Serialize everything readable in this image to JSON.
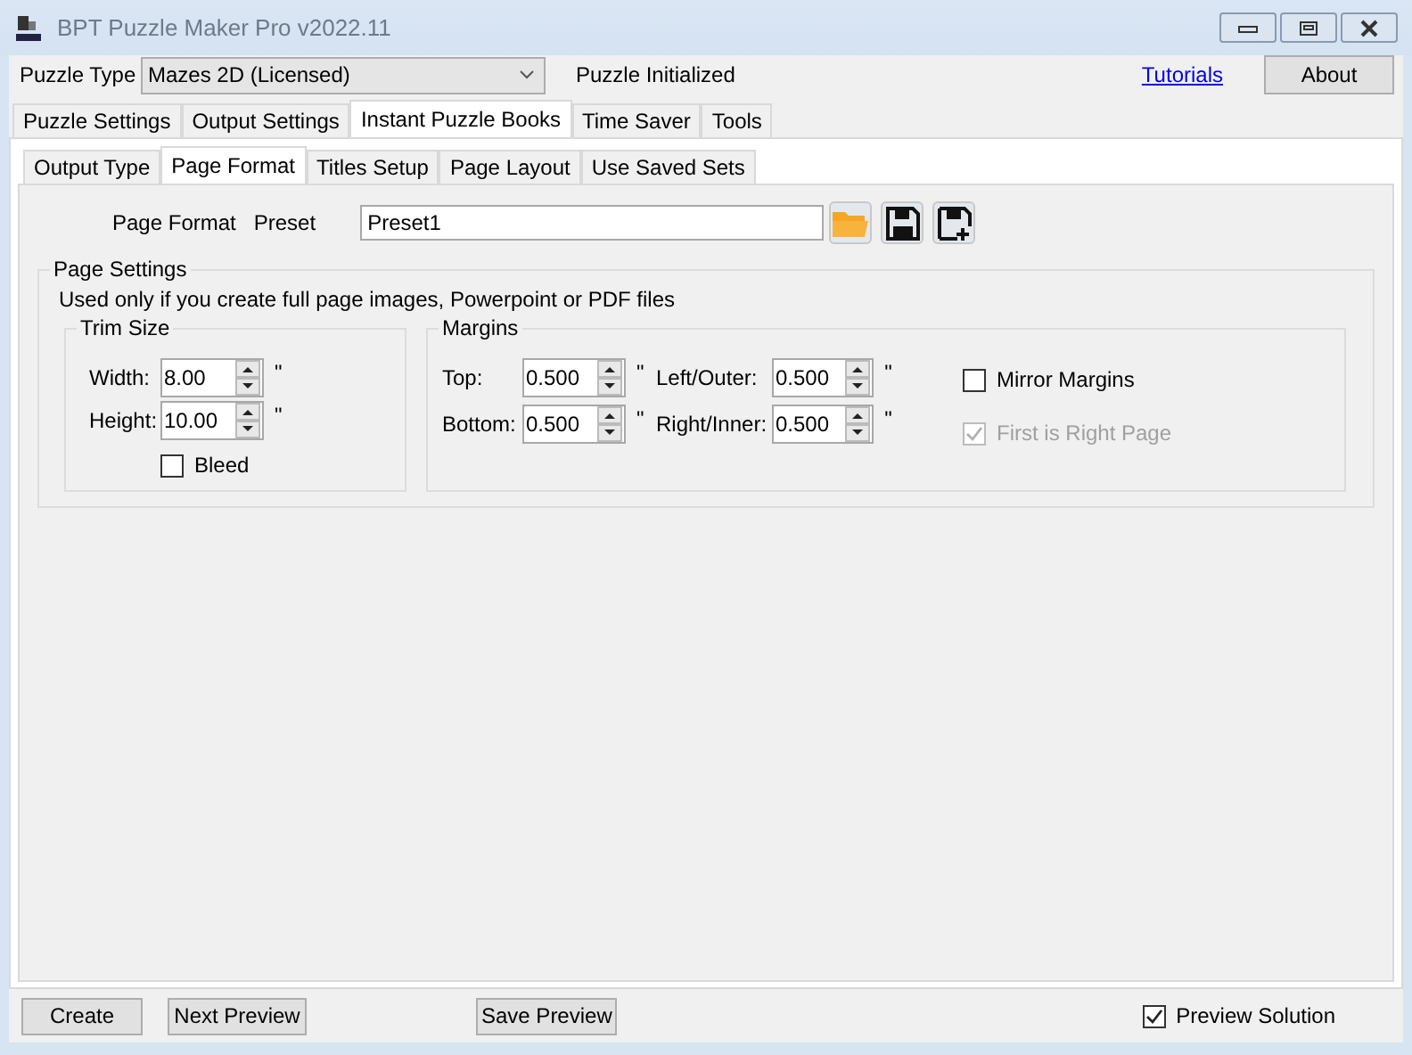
{
  "window": {
    "title": "BPT Puzzle Maker Pro v2022.11"
  },
  "top_bar": {
    "puzzle_type_label": "Puzzle Type",
    "puzzle_type_value": "Mazes 2D (Licensed)",
    "status": "Puzzle Initialized",
    "link": "Tutorials",
    "button": "About"
  },
  "main_tabs": [
    {
      "label": "Puzzle Settings",
      "selected": false
    },
    {
      "label": "Output Settings",
      "selected": false
    },
    {
      "label": "Instant Puzzle Books",
      "selected": true
    },
    {
      "label": "Time Saver",
      "selected": false
    },
    {
      "label": "Tools",
      "selected": false
    }
  ],
  "sub_tabs": [
    {
      "label": "Output Type",
      "selected": false
    },
    {
      "label": "Page Format",
      "selected": true
    },
    {
      "label": "Titles Setup",
      "selected": false
    },
    {
      "label": "Page Layout",
      "selected": false
    },
    {
      "label": "Use Saved Sets",
      "selected": false
    }
  ],
  "preset": {
    "label": "Page Format",
    "label_2": "Preset",
    "value": "Preset1"
  },
  "page_settings": {
    "title": "Page Settings",
    "note": "Used only if you create full page images, Powerpoint or PDF files",
    "trim_size": {
      "title": "Trim Size",
      "fields": [
        {
          "label": "Width:",
          "value": "8.00",
          "unit": "\""
        },
        {
          "label": "Height:",
          "value": "10.00",
          "unit": "\""
        }
      ],
      "bleed": {
        "label": "Bleed",
        "checked": false,
        "disabled": false
      }
    },
    "margins": {
      "title": "Margins",
      "fields": [
        {
          "label": "Top:",
          "value": "0.500",
          "unit": "\""
        },
        {
          "label": "Left/Outer:",
          "value": "0.500",
          "unit": "\""
        },
        {
          "label": "Bottom:",
          "value": "0.500",
          "unit": "\""
        },
        {
          "label": "Right/Inner:",
          "value": "0.500",
          "unit": "\""
        }
      ],
      "options": [
        {
          "label": "Mirror Margins",
          "checked": false,
          "disabled": false
        },
        {
          "label": "First is Right Page",
          "checked": true,
          "disabled": true
        }
      ]
    }
  },
  "footer": {
    "buttons": [
      "Create",
      "Next Preview",
      "Save Preview"
    ],
    "preview_solution": {
      "label": "Preview Solution",
      "checked": true,
      "disabled": false
    }
  }
}
